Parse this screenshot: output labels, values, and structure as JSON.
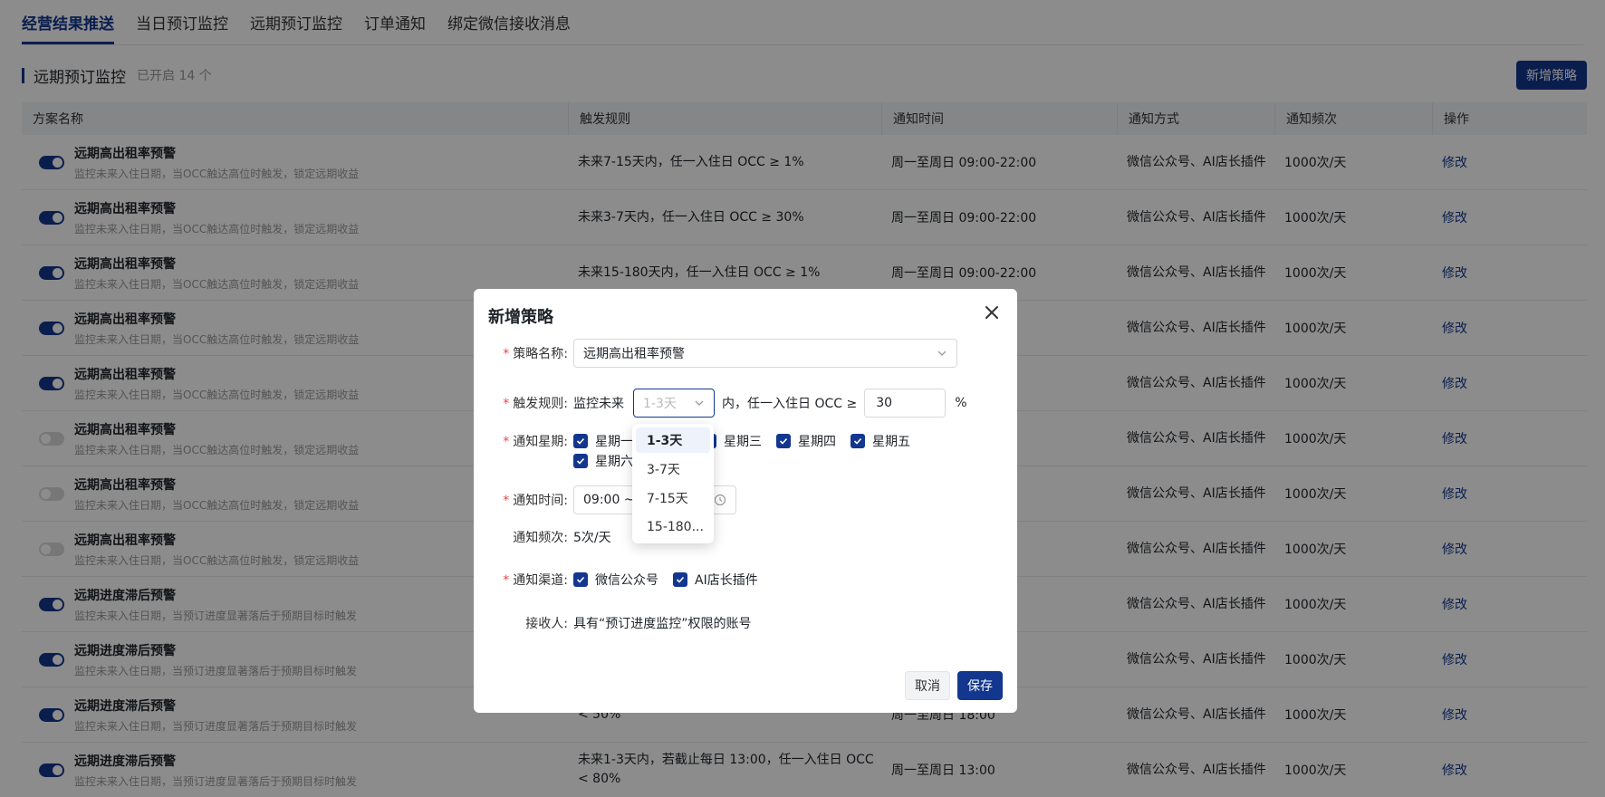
{
  "tabs": [
    "经营结果推送",
    "当日预订监控",
    "远期预订监控",
    "订单通知",
    "绑定微信接收消息"
  ],
  "section": {
    "title": "远期预订监控",
    "count": "已开启 14 个",
    "add_button": "新增策略"
  },
  "table": {
    "columns": [
      "方案名称",
      "触发规则",
      "通知时间",
      "通知方式",
      "通知频次",
      "操作"
    ],
    "rows": [
      {
        "on": true,
        "name": "远期高出租率预警",
        "desc": "监控未来入住日期，当OCC触达高位时触发，锁定远期收益",
        "rule": "未来7-15天内，任一入住日 OCC ≥ 1%",
        "time": "周一至周日 09:00-22:00",
        "method": "微信公众号、AI店长插件",
        "freq": "1000次/天",
        "op": "修改"
      },
      {
        "on": true,
        "name": "远期高出租率预警",
        "desc": "监控未来入住日期，当OCC触达高位时触发，锁定远期收益",
        "rule": "未来3-7天内，任一入住日 OCC ≥ 30%",
        "time": "周一至周日 09:00-22:00",
        "method": "微信公众号、AI店长插件",
        "freq": "1000次/天",
        "op": "修改"
      },
      {
        "on": true,
        "name": "远期高出租率预警",
        "desc": "监控未来入住日期，当OCC触达高位时触发，锁定远期收益",
        "rule": "未来15-180天内，任一入住日 OCC ≥ 1%",
        "time": "周一至周日 09:00-22:00",
        "method": "微信公众号、AI店长插件",
        "freq": "1000次/天",
        "op": "修改"
      },
      {
        "on": true,
        "name": "远期高出租率预警",
        "desc": "监控未来入住日期，当OCC触达高位时触发，锁定远期收益",
        "rule": "",
        "time": "00",
        "method": "微信公众号、AI店长插件",
        "freq": "1000次/天",
        "op": "修改"
      },
      {
        "on": true,
        "name": "远期高出租率预警",
        "desc": "监控未来入住日期，当OCC触达高位时触发，锁定远期收益",
        "rule": "",
        "time": "00",
        "method": "微信公众号、AI店长插件",
        "freq": "1000次/天",
        "op": "修改"
      },
      {
        "on": false,
        "name": "远期高出租率预警",
        "desc": "监控未来入住日期，当OCC触达高位时触发，锁定远期收益",
        "rule": "",
        "time": "00-21:00",
        "method": "微信公众号、AI店长插件",
        "freq": "1000次/天",
        "op": "修改"
      },
      {
        "on": false,
        "name": "远期高出租率预警",
        "desc": "监控未来入住日期，当OCC触达高位时触发，锁定远期收益",
        "rule": "",
        "time": "00-21:00",
        "method": "微信公众号、AI店长插件",
        "freq": "1000次/天",
        "op": "修改"
      },
      {
        "on": false,
        "name": "远期高出租率预警",
        "desc": "监控未来入住日期，当OCC触达高位时触发，锁定远期收益",
        "rule": "",
        "time": "00",
        "method": "微信公众号、AI店长插件",
        "freq": "1000次/天",
        "op": "修改"
      },
      {
        "on": true,
        "name": "远期进度滞后预警",
        "desc": "监控未来入住日期，当预订进度显著落后于预期目标时触发",
        "rule": "",
        "time": "",
        "method": "微信公众号、AI店长插件",
        "freq": "1000次/天",
        "op": "修改"
      },
      {
        "on": true,
        "name": "远期进度滞后预警",
        "desc": "监控未来入住日期，当预订进度显著落后于预期目标时触发",
        "rule": "",
        "time": "",
        "method": "微信公众号、AI店长插件",
        "freq": "1000次/天",
        "op": "修改"
      },
      {
        "on": true,
        "name": "远期进度滞后预警",
        "desc": "监控未来入住日期，当预订进度显著落后于预期目标时触发",
        "rule": "< 50%",
        "time": "周一至周日 18:00",
        "method": "微信公众号、AI店长插件",
        "freq": "1000次/天",
        "op": "修改"
      },
      {
        "on": true,
        "name": "远期进度滞后预警",
        "desc": "监控未来入住日期，当预订进度显著落后于预期目标时触发",
        "rule": "未来1-3天内，若截止每日 13:00，任一入住日 OCC < 80%",
        "time": "周一至周日 13:00",
        "method": "微信公众号、AI店长插件",
        "freq": "1000次/天",
        "op": "修改"
      }
    ]
  },
  "modal": {
    "title": "新增策略",
    "name_label": "策略名称:",
    "name_value": "远期高出租率预警",
    "rule_label": "触发规则:",
    "rule_prefix": "监控未来",
    "rule_select_placeholder": "1-3天",
    "rule_mid": "内，任一入住日 OCC ≥",
    "rule_value": "30",
    "rule_unit": "%",
    "weekday_label": "通知星期:",
    "weekdays": [
      "星期一",
      "星期三",
      "星期四",
      "星期五",
      "星期六"
    ],
    "time_label": "通知时间:",
    "time_value": "09:00 ~",
    "freq_label": "通知频次:",
    "freq_value": "5次/天",
    "channel_label": "通知渠道:",
    "channels": [
      "微信公众号",
      "AI店长插件"
    ],
    "receiver_label": "接收人:",
    "receiver_value": "具有“预订进度监控”权限的账号",
    "cancel": "取消",
    "save": "保存"
  },
  "dropdown": {
    "options": [
      "1-3天",
      "3-7天",
      "7-15天",
      "15-180..."
    ],
    "selected": "1-3天"
  },
  "colors": {
    "primary": "#13378f",
    "required": "#e5484d"
  }
}
